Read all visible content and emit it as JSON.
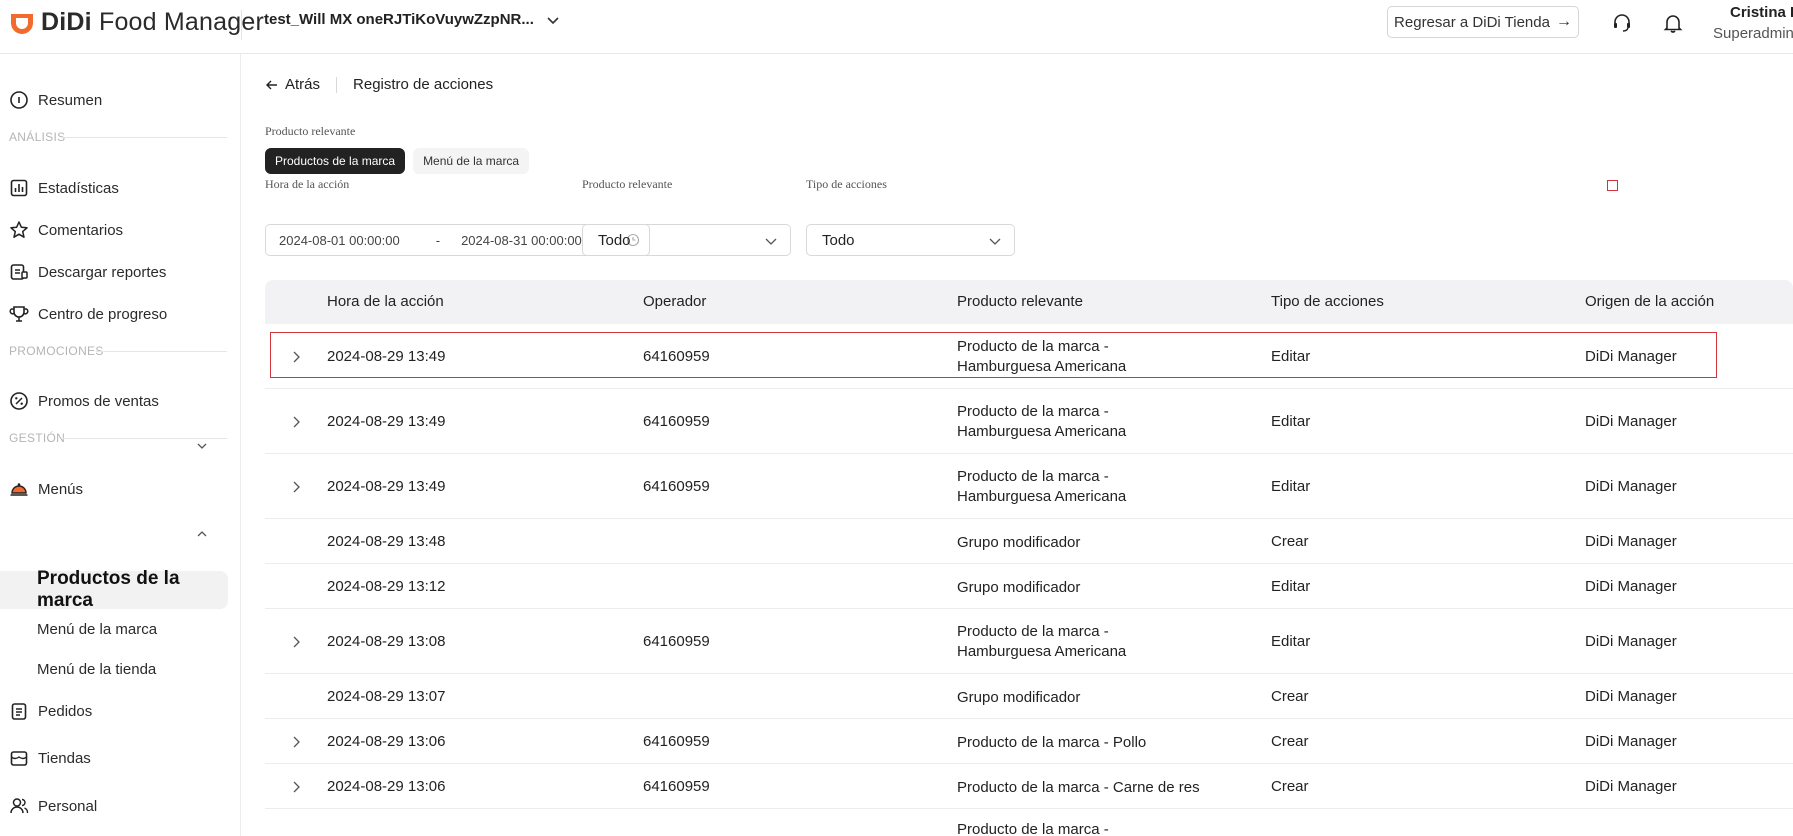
{
  "header": {
    "logo_brand": "DiDi",
    "logo_product": "Food Manager",
    "store_name": "test_Will MX oneRJTiKoVuywZzpNR...",
    "back_button": "Regresar a DiDi Tienda",
    "back_arrow": "→",
    "user_name": "Cristina De",
    "user_role": "Superadminis"
  },
  "sidebar": {
    "resumen": "Resumen",
    "section_analisis": "ANÁLISIS",
    "estadisticas": "Estadísticas",
    "comentarios": "Comentarios",
    "descargar": "Descargar reportes",
    "progreso": "Centro de progreso",
    "section_promociones": "PROMOCIONES",
    "promos": "Promos de ventas",
    "section_gestion": "GESTIÓN",
    "menus": "Menús",
    "productos_marca": "Productos de la marca",
    "menu_marca": "Menú de la marca",
    "menu_tienda": "Menú de la tienda",
    "pedidos": "Pedidos",
    "tiendas": "Tiendas",
    "personal": "Personal"
  },
  "main": {
    "back": "Atrás",
    "title": "Registro de acciones",
    "product_label": "Producto relevante",
    "seg_productos": "Productos de la marca",
    "seg_menu": "Menú de la marca",
    "time_label": "Hora de la acción",
    "date_from": "2024-08-01 00:00:00",
    "date_sep": "-",
    "date_to": "2024-08-31 00:00:00",
    "filter_product_label": "Producto relevante",
    "filter_product_value": "Todo",
    "filter_type_label": "Tipo de acciones",
    "filter_type_value": "Todo"
  },
  "table": {
    "headers": [
      "Hora de la acción",
      "Operador",
      "Producto relevante",
      "Tipo de acciones",
      "Origen de la acción"
    ],
    "rows": [
      {
        "time": "2024-08-29 13:49",
        "operator": "64160959",
        "product": "Producto de la marca - Hamburguesa Americana",
        "type": "Editar",
        "origin": "DiDi Manager",
        "expandable": true
      },
      {
        "time": "2024-08-29 13:49",
        "operator": "64160959",
        "product": "Producto de la marca - Hamburguesa Americana",
        "type": "Editar",
        "origin": "DiDi Manager",
        "expandable": true
      },
      {
        "time": "2024-08-29 13:49",
        "operator": "64160959",
        "product": "Producto de la marca - Hamburguesa Americana",
        "type": "Editar",
        "origin": "DiDi Manager",
        "expandable": true
      },
      {
        "time": "2024-08-29 13:48",
        "operator": "",
        "product": "Grupo modificador",
        "type": "Crear",
        "origin": "DiDi Manager",
        "expandable": false
      },
      {
        "time": "2024-08-29 13:12",
        "operator": "",
        "product": "Grupo modificador",
        "type": "Editar",
        "origin": "DiDi Manager",
        "expandable": false
      },
      {
        "time": "2024-08-29 13:08",
        "operator": "64160959",
        "product": "Producto de la marca - Hamburguesa Americana",
        "type": "Editar",
        "origin": "DiDi Manager",
        "expandable": true
      },
      {
        "time": "2024-08-29 13:07",
        "operator": "",
        "product": "Grupo modificador",
        "type": "Crear",
        "origin": "DiDi Manager",
        "expandable": false
      },
      {
        "time": "2024-08-29 13:06",
        "operator": "64160959",
        "product": "Producto de la marca - Pollo",
        "type": "Crear",
        "origin": "DiDi Manager",
        "expandable": true
      },
      {
        "time": "2024-08-29 13:06",
        "operator": "64160959",
        "product": "Producto de la marca - Carne de res",
        "type": "Crear",
        "origin": "DiDi Manager",
        "expandable": true
      },
      {
        "time": "",
        "operator": "",
        "product": "Producto de la marca - Hamburguesa",
        "type": "",
        "origin": "",
        "expandable": false
      }
    ]
  },
  "colors": {
    "brand_orange": "#f26a2e",
    "highlight_red": "#d0363b",
    "active_dark": "#222222"
  }
}
